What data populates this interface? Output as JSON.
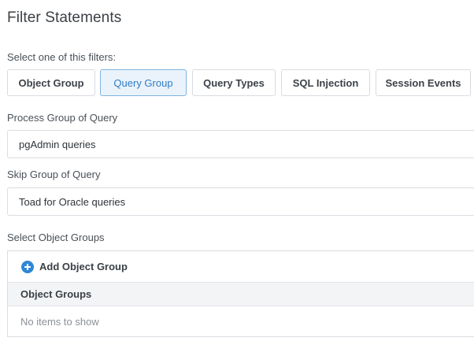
{
  "page_title": "Filter Statements",
  "filters": {
    "label": "Select one of this filters:",
    "tabs": [
      {
        "label": "Object Group"
      },
      {
        "label": "Query Group"
      },
      {
        "label": "Query Types"
      },
      {
        "label": "SQL Injection"
      },
      {
        "label": "Session Events"
      }
    ],
    "selected": "Query Group"
  },
  "process_group": {
    "label": "Process Group of Query",
    "value": "pgAdmin queries"
  },
  "skip_group": {
    "label": "Skip Group of Query",
    "value": "Toad for Oracle queries"
  },
  "object_groups": {
    "label": "Select Object Groups",
    "add_button": "Add Object Group",
    "column_header": "Object Groups",
    "empty_text": "No items to show"
  },
  "colors": {
    "accent": "#2f86d6",
    "active_tab_bg": "#eaf3fb",
    "active_tab_text": "#2f7cc4"
  }
}
